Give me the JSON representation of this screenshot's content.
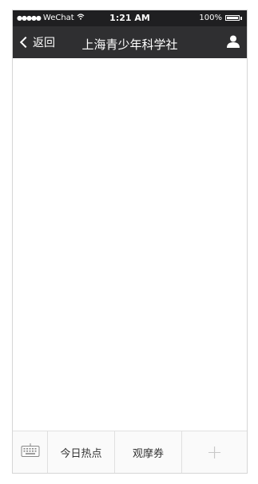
{
  "status_bar": {
    "signal": "●●●●●",
    "carrier": "WeChat",
    "time": "1:21 AM",
    "battery": "100%"
  },
  "nav": {
    "back_label": "返回",
    "title": "上海青少年科学社"
  },
  "bottom_menu": {
    "items": [
      "今日热点",
      "观摩券"
    ],
    "plus": "+"
  },
  "icons": {
    "back": "chevron-left-icon",
    "profile": "person-icon",
    "keyboard": "keyboard-icon",
    "wifi": "wifi-icon"
  },
  "colors": {
    "status_bg": "#1f1f21",
    "nav_bg": "#2f2f31"
  }
}
